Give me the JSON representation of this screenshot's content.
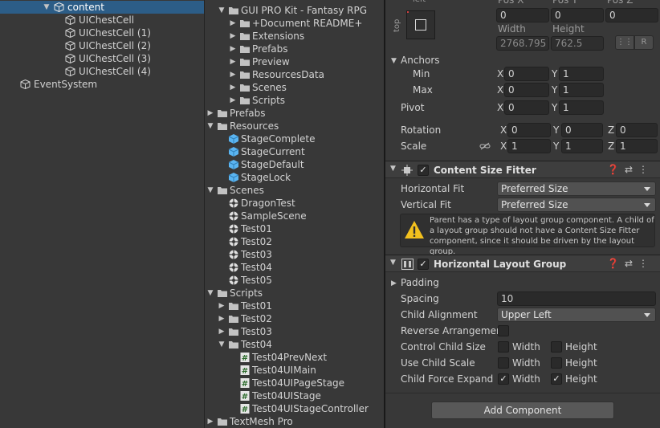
{
  "hierarchy": {
    "items": [
      {
        "label": "content",
        "selected": true,
        "expanded": true
      },
      {
        "label": "UIChestCell"
      },
      {
        "label": "UIChestCell (1)"
      },
      {
        "label": "UIChestCell (2)"
      },
      {
        "label": "UIChestCell (3)"
      },
      {
        "label": "UIChestCell (4)"
      },
      {
        "label": "EventSystem"
      }
    ]
  },
  "project": {
    "items": [
      {
        "label": "GUI PRO Kit - Fantasy RPG",
        "type": "folder",
        "expanded": true
      },
      {
        "label": "+Document README+",
        "type": "folder"
      },
      {
        "label": "Extensions",
        "type": "folder"
      },
      {
        "label": "Prefabs",
        "type": "folder"
      },
      {
        "label": "Preview",
        "type": "folder"
      },
      {
        "label": "ResourcesData",
        "type": "folder"
      },
      {
        "label": "Scenes",
        "type": "folder"
      },
      {
        "label": "Scripts",
        "type": "folder"
      },
      {
        "label": "Prefabs",
        "type": "folder"
      },
      {
        "label": "Resources",
        "type": "folder",
        "expanded": true
      },
      {
        "label": "StageComplete",
        "type": "prefab"
      },
      {
        "label": "StageCurrent",
        "type": "prefab"
      },
      {
        "label": "StageDefault",
        "type": "prefab"
      },
      {
        "label": "StageLock",
        "type": "prefab"
      },
      {
        "label": "Scenes",
        "type": "folder",
        "expanded": true
      },
      {
        "label": "DragonTest",
        "type": "scene"
      },
      {
        "label": "SampleScene",
        "type": "scene"
      },
      {
        "label": "Test01",
        "type": "scene"
      },
      {
        "label": "Test02",
        "type": "scene"
      },
      {
        "label": "Test03",
        "type": "scene"
      },
      {
        "label": "Test04",
        "type": "scene"
      },
      {
        "label": "Test05",
        "type": "scene"
      },
      {
        "label": "Scripts",
        "type": "folder",
        "expanded": true
      },
      {
        "label": "Test01",
        "type": "folder"
      },
      {
        "label": "Test02",
        "type": "folder"
      },
      {
        "label": "Test03",
        "type": "folder"
      },
      {
        "label": "Test04",
        "type": "folder",
        "expanded": true
      },
      {
        "label": "Test04PrevNext",
        "type": "script"
      },
      {
        "label": "Test04UIMain",
        "type": "script"
      },
      {
        "label": "Test04UIPageStage",
        "type": "script"
      },
      {
        "label": "Test04UIStage",
        "type": "script"
      },
      {
        "label": "Test04UIStageController",
        "type": "script"
      },
      {
        "label": "TextMesh Pro",
        "type": "folder"
      }
    ]
  },
  "inspector": {
    "rect": {
      "anchor_top_label": "left",
      "anchor_side_label": "top",
      "pos_x_label": "Pos X",
      "pos_y_label": "Pos Y",
      "pos_z_label": "Pos Z",
      "pos_x": "0",
      "pos_y": "0",
      "pos_z": "0",
      "width_label": "Width",
      "height_label": "Height",
      "width": "2768.795",
      "height": "762.5",
      "raw_button": "R",
      "anchors_label": "Anchors",
      "min_label": "Min",
      "max_label": "Max",
      "min_x": "0",
      "min_y": "1",
      "max_x": "0",
      "max_y": "1",
      "pivot_label": "Pivot",
      "pivot_x": "0",
      "pivot_y": "1",
      "rotation_label": "Rotation",
      "rot_x": "0",
      "rot_y": "0",
      "rot_z": "0",
      "scale_label": "Scale",
      "scale_x": "1",
      "scale_y": "1",
      "scale_z": "1",
      "axis_x": "X",
      "axis_y": "Y",
      "axis_z": "Z"
    },
    "content_size_fitter": {
      "title": "Content Size Fitter",
      "enabled": true,
      "horizontal_fit_label": "Horizontal Fit",
      "horizontal_fit": "Preferred Size",
      "vertical_fit_label": "Vertical Fit",
      "vertical_fit": "Preferred Size",
      "warning": "Parent has a type of layout group component. A child of a layout group should not have a Content Size Fitter component, since it should be driven by the layout group."
    },
    "horizontal_layout_group": {
      "title": "Horizontal Layout Group",
      "enabled": true,
      "padding_label": "Padding",
      "spacing_label": "Spacing",
      "spacing": "10",
      "child_alignment_label": "Child Alignment",
      "child_alignment": "Upper Left",
      "reverse_label": "Reverse Arrangement",
      "reverse": false,
      "control_child_size_label": "Control Child Size",
      "control_width": false,
      "control_height": false,
      "use_child_scale_label": "Use Child Scale",
      "scale_width": false,
      "scale_height": false,
      "child_force_expand_label": "Child Force Expand",
      "expand_width": true,
      "expand_height": true,
      "width_label": "Width",
      "height_label": "Height"
    },
    "add_component_label": "Add Component"
  },
  "colors": {
    "selection": "#2c5d87",
    "prefab_blue": "#5ab4f0",
    "warning_yellow": "#f2c01e"
  }
}
